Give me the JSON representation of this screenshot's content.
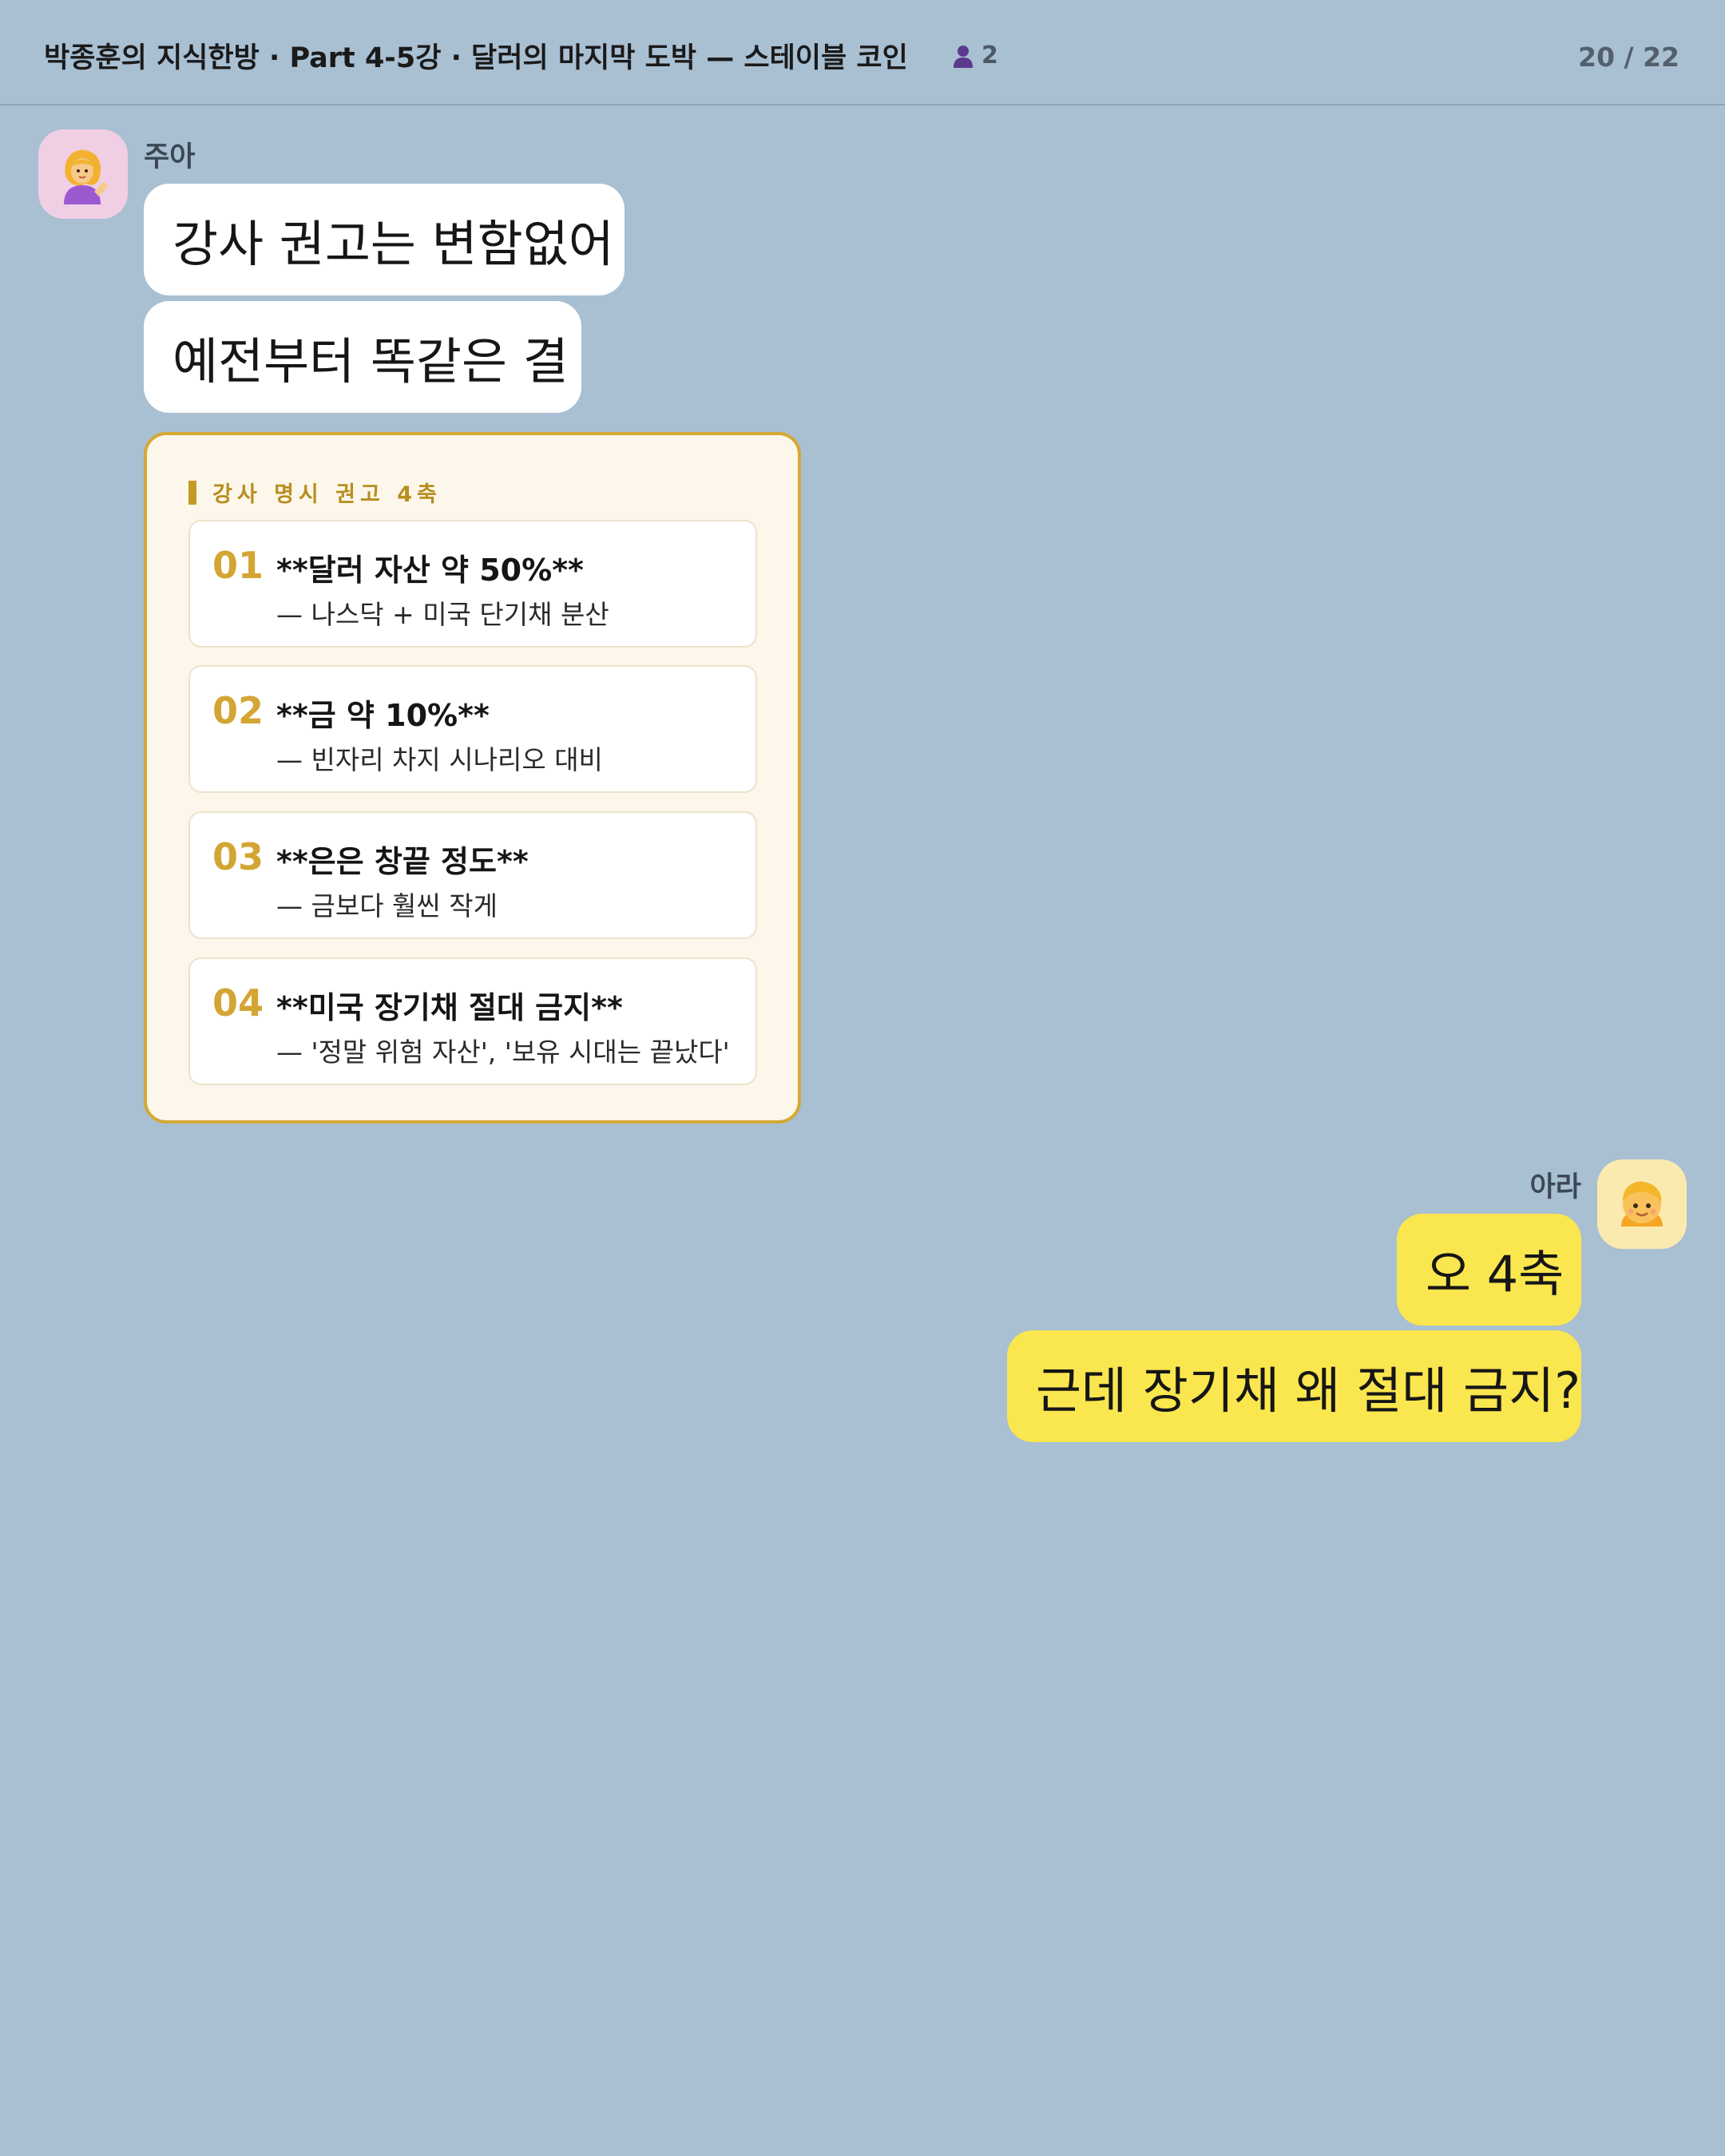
{
  "header": {
    "title": "박종훈의 지식한방 · Part 4-5강 · 달러의 마지막 도박 — 스테이블 코인",
    "member_icon": "person-icon",
    "member_count": "2",
    "page_indicator": "20 / 22"
  },
  "messages": [
    {
      "sender": "주아",
      "avatar_icon": "woman-tipping-hand-emoji",
      "bubbles": [
        "강사 권고는 변함없어",
        "예전부터 똑같은 결"
      ],
      "card": {
        "title": "강사 명시 권고 4축",
        "items": [
          {
            "num": "01",
            "title": "**달러 자산 약 50%**",
            "sub": "— 나스닥 + 미국 단기채 분산"
          },
          {
            "num": "02",
            "title": "**금 약 10%**",
            "sub": "— 빈자리 차지 시나리오 대비"
          },
          {
            "num": "03",
            "title": "**은은 창끝 정도**",
            "sub": "— 금보다 훨씬 작게"
          },
          {
            "num": "04",
            "title": "**미국 장기채 절대 금지**",
            "sub": "— '정말 위험 자산', '보유 시대는 끝났다'"
          }
        ]
      }
    },
    {
      "sender": "아라",
      "avatar_icon": "child-face-emoji",
      "bubbles": [
        "오 4축",
        "근데 장기채 왜 절대 금지?"
      ]
    }
  ],
  "colors": {
    "background": "#a9bfd2",
    "my_bubble": "#fae64e",
    "other_bubble": "#ffffff",
    "card_accent": "#d4a935"
  }
}
